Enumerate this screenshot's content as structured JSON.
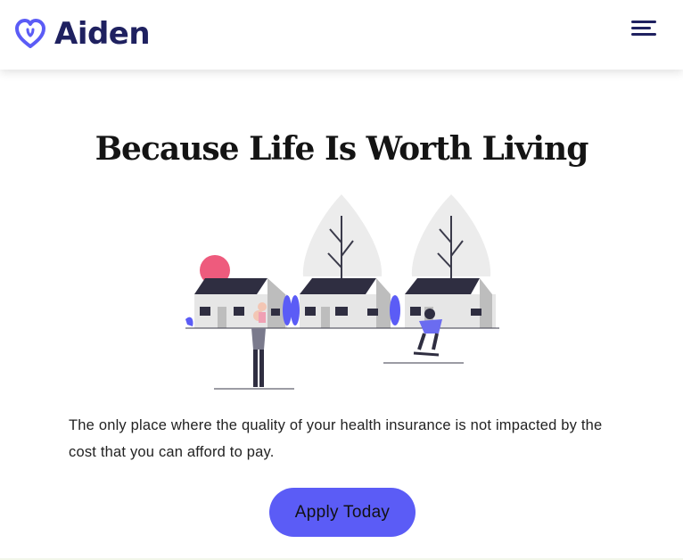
{
  "header": {
    "brand": "Aiden",
    "logo_icon": "heart-icon",
    "menu_icon": "hamburger-menu-icon",
    "brand_color": "#1f2160",
    "accent_color": "#5b5cf6"
  },
  "hero": {
    "title": "Because Life Is Worth Living",
    "illustration_icon": "houses-family-illustration",
    "description": "The only place where the quality of your health insurance is not impacted by the cost that you can afford to pay.",
    "cta_label": "Apply Today"
  }
}
